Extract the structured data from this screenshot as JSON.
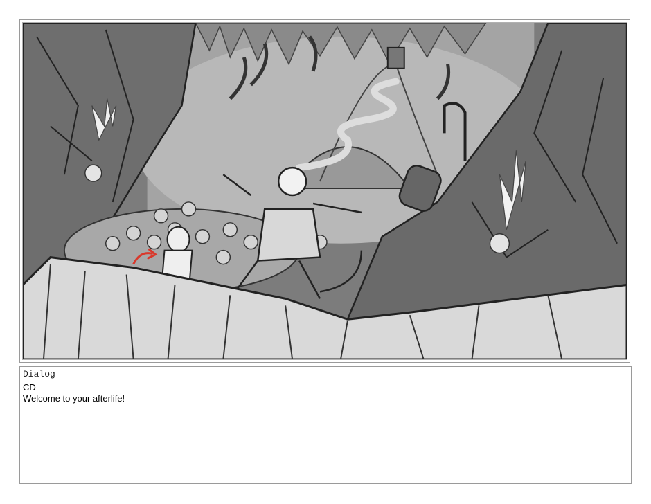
{
  "storyboard_panel": {
    "image_semantic": "storyboard-sketch-underworld-cavern"
  },
  "dialog": {
    "title": "Dialog",
    "speaker": "CD",
    "line": "Welcome to your afterlife!"
  },
  "colors": {
    "frame_border": "#9a9a9a",
    "sketch_accent_red": "#d9382b"
  }
}
